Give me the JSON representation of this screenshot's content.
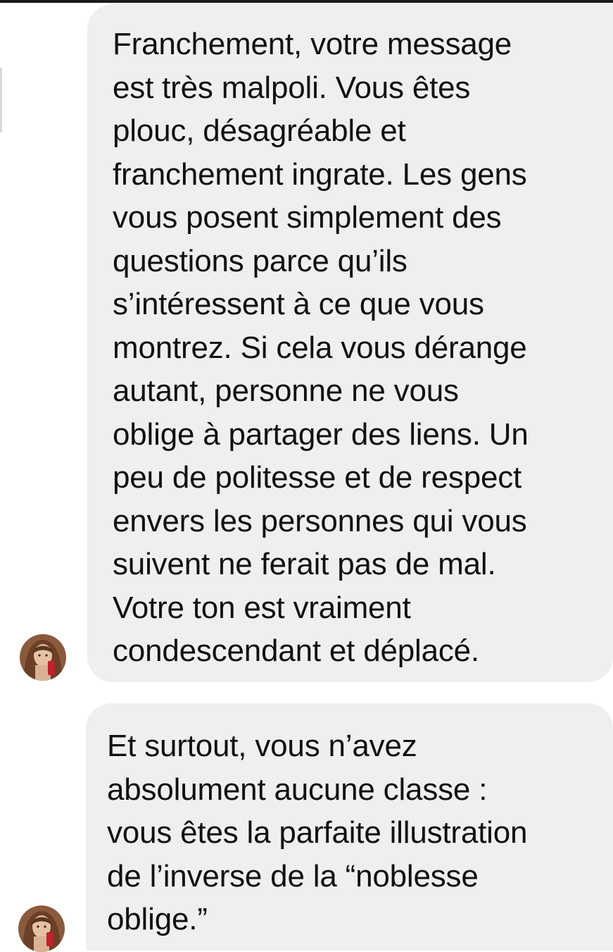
{
  "conversation": {
    "messages": [
      {
        "sender": "other",
        "lines": [
          "Franchement, votre message",
          "est très malpoli. Vous êtes",
          "plouc, désagréable et",
          "franchement ingrate. Les gens",
          "vous posent simplement des",
          "questions parce qu’ils",
          "s’intéressent à ce que vous",
          "montrez. Si cela vous dérange",
          "autant, personne ne vous",
          "oblige à partager des liens. Un",
          "peu de politesse et de respect",
          "envers les personnes qui vous",
          "suivent ne ferait pas de mal.",
          "Votre ton est vraiment",
          "condescendant et déplacé."
        ]
      },
      {
        "sender": "other",
        "lines": [
          "Et surtout, vous n’avez",
          "absolument aucune classe :",
          "vous êtes la parfaite illustration",
          "de l’inverse de la “noblesse",
          "oblige.”"
        ]
      }
    ],
    "avatar_icon": "profile-photo-avatar",
    "bubble_color": "#efeff0",
    "text_color": "#111111"
  }
}
